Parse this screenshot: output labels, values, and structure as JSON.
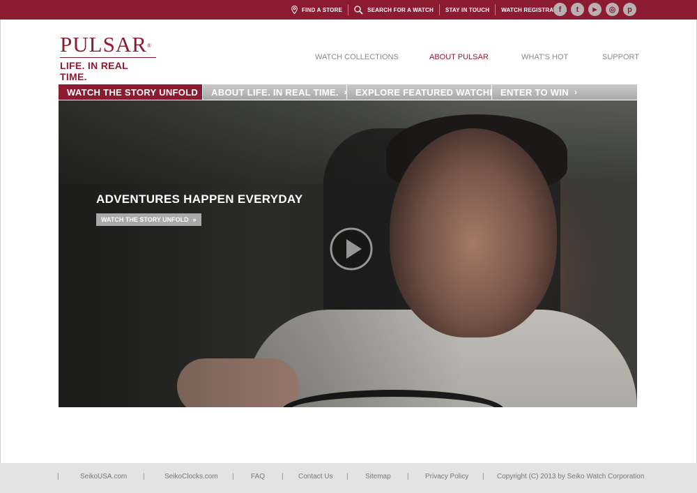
{
  "topbar": {
    "links": [
      {
        "label": "FIND A STORE",
        "icon": "location-pin-icon"
      },
      {
        "label": "SEARCH FOR A WATCH",
        "icon": "search-icon"
      },
      {
        "label": "STAY IN TOUCH",
        "icon": ""
      },
      {
        "label": "WATCH REGISTRATION",
        "icon": ""
      }
    ],
    "social": [
      {
        "icon": "facebook-icon",
        "glyph": "f"
      },
      {
        "icon": "twitter-icon",
        "glyph": "t"
      },
      {
        "icon": "youtube-icon",
        "glyph": "▶"
      },
      {
        "icon": "instagram-icon",
        "glyph": "◎"
      },
      {
        "icon": "pinterest-icon",
        "glyph": "p"
      }
    ]
  },
  "logo": {
    "brand": "PULSAR",
    "registered": "®",
    "tagline": "LIFE. IN REAL TIME."
  },
  "nav": {
    "items": [
      "WATCH COLLECTIONS",
      "ABOUT PULSAR",
      "WHAT'S HOT",
      "SUPPORT"
    ],
    "active": "ABOUT PULSAR"
  },
  "tabs": {
    "items": [
      "WATCH THE STORY UNFOLD",
      "ABOUT LIFE. IN REAL TIME.",
      "EXPLORE FEATURED WATCHES",
      "ENTER TO WIN"
    ],
    "chevron": "›"
  },
  "hero": {
    "headline": "ADVENTURES HAPPEN EVERYDAY",
    "cta": "WATCH THE STORY UNFOLD",
    "cta_chevron": "»"
  },
  "footer": {
    "links": [
      "SeikoUSA.com",
      "SeikoClocks.com",
      "FAQ",
      "Contact Us",
      "Sitemap",
      "Privacy Policy"
    ],
    "copyright": "Copyright (C) 2013 by Seiko Watch Corporation",
    "separator": "|"
  },
  "colors": {
    "brand": "#8c1b32",
    "tab_inactive": "#a9a9a9",
    "footer_bg": "#e3e3e3"
  }
}
